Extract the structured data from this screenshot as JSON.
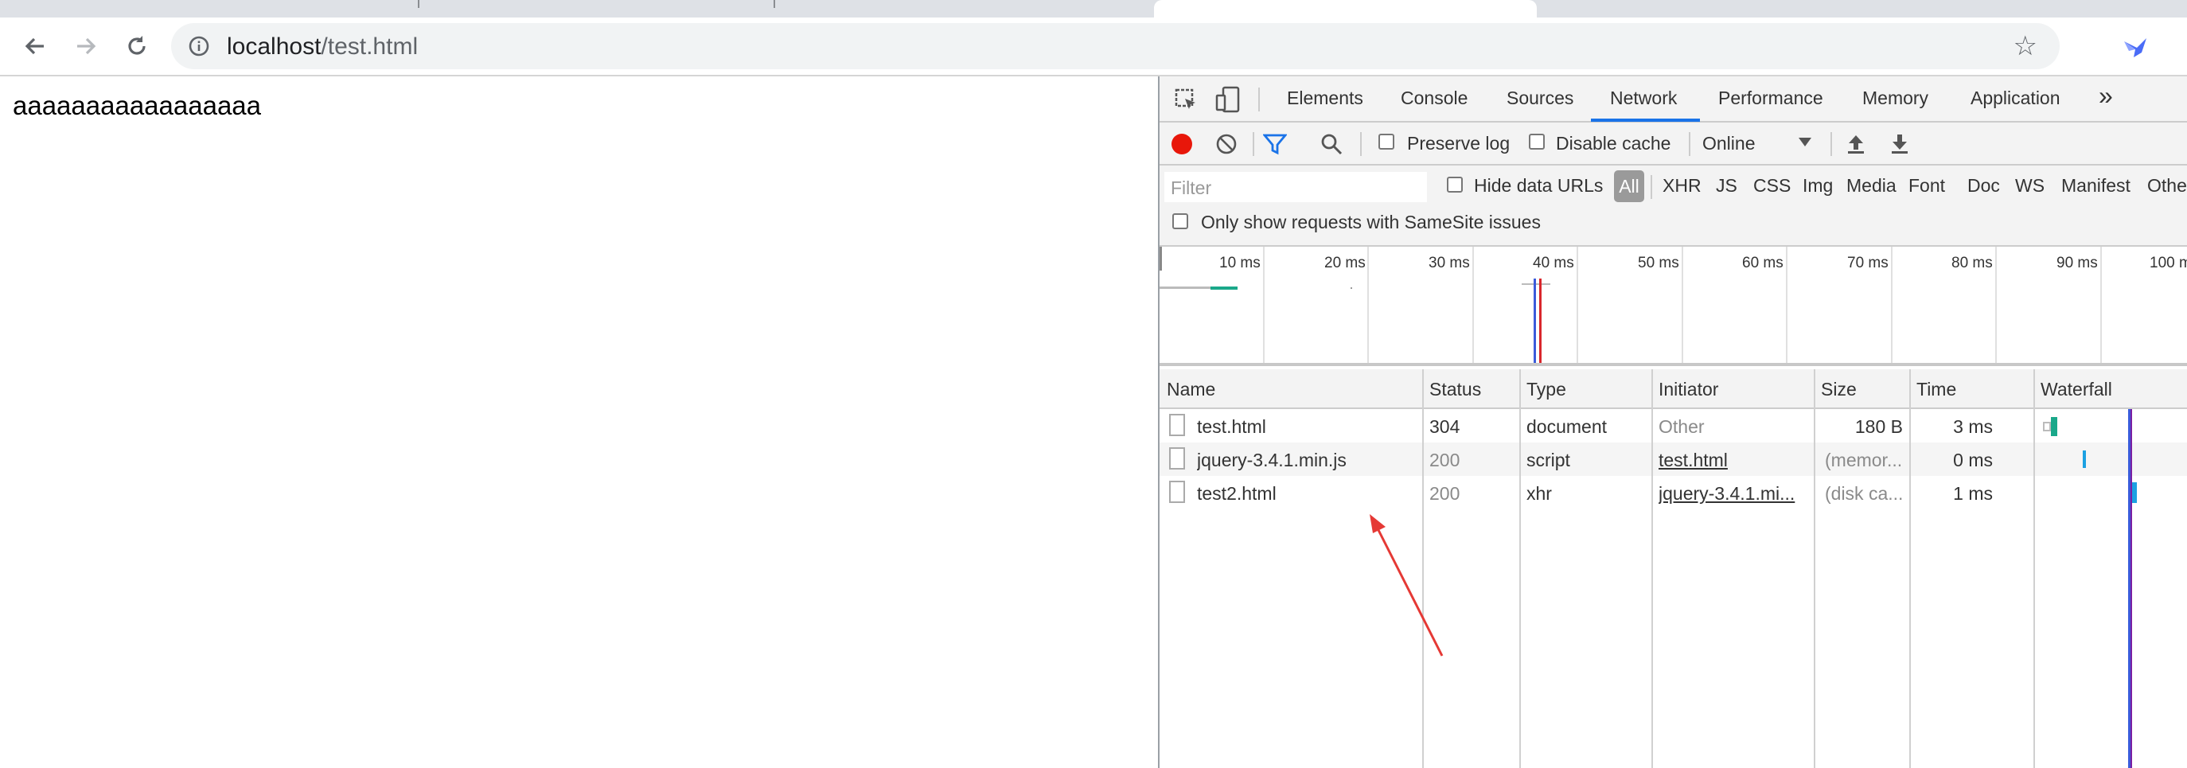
{
  "browser": {
    "address": {
      "host": "localhost",
      "path": "/test.html"
    },
    "icons": [
      "back-arrow-icon",
      "forward-arrow-icon",
      "reload-icon",
      "info-icon",
      "star-icon",
      "extension-bird-icon"
    ]
  },
  "page": {
    "content_text": "aaaaaaaaaaaaaaaaa"
  },
  "devtools": {
    "tabs": [
      "Elements",
      "Console",
      "Sources",
      "Network",
      "Performance",
      "Memory",
      "Application"
    ],
    "active_tab": "Network",
    "more_icon": "»",
    "controls": {
      "preserve_log": "Preserve log",
      "disable_cache": "Disable cache",
      "throttle": "Online"
    },
    "filter": {
      "placeholder": "Filter",
      "hide_data_urls": "Hide data URLs",
      "all": "All",
      "types": [
        "XHR",
        "JS",
        "CSS",
        "Img",
        "Media",
        "Font",
        "Doc",
        "WS",
        "Manifest",
        "Othe"
      ],
      "samesite": "Only show requests with SameSite issues"
    },
    "timeline": {
      "ticks": [
        "10 ms",
        "20 ms",
        "30 ms",
        "40 ms",
        "50 ms",
        "60 ms",
        "70 ms",
        "80 ms",
        "90 ms",
        "100 m"
      ]
    },
    "columns": {
      "name": "Name",
      "status": "Status",
      "type": "Type",
      "initiator": "Initiator",
      "size": "Size",
      "time": "Time",
      "waterfall": "Waterfall"
    },
    "requests": [
      {
        "name": "test.html",
        "status": "304",
        "type": "document",
        "initiator": "Other",
        "size": "180 B",
        "time": "3 ms"
      },
      {
        "name": "jquery-3.4.1.min.js",
        "status": "200",
        "type": "script",
        "initiator": "test.html",
        "size": "(memor...",
        "time": "0 ms"
      },
      {
        "name": "test2.html",
        "status": "200",
        "type": "xhr",
        "initiator": "jquery-3.4.1.mi...",
        "size": "(disk ca...",
        "time": "1 ms"
      }
    ]
  },
  "colors": {
    "record": "#e8170a",
    "accent": "#1a73e8",
    "arrow": "#e53935",
    "waterfall_green": "#1aa88a",
    "waterfall_blue": "#1ba1e2"
  }
}
